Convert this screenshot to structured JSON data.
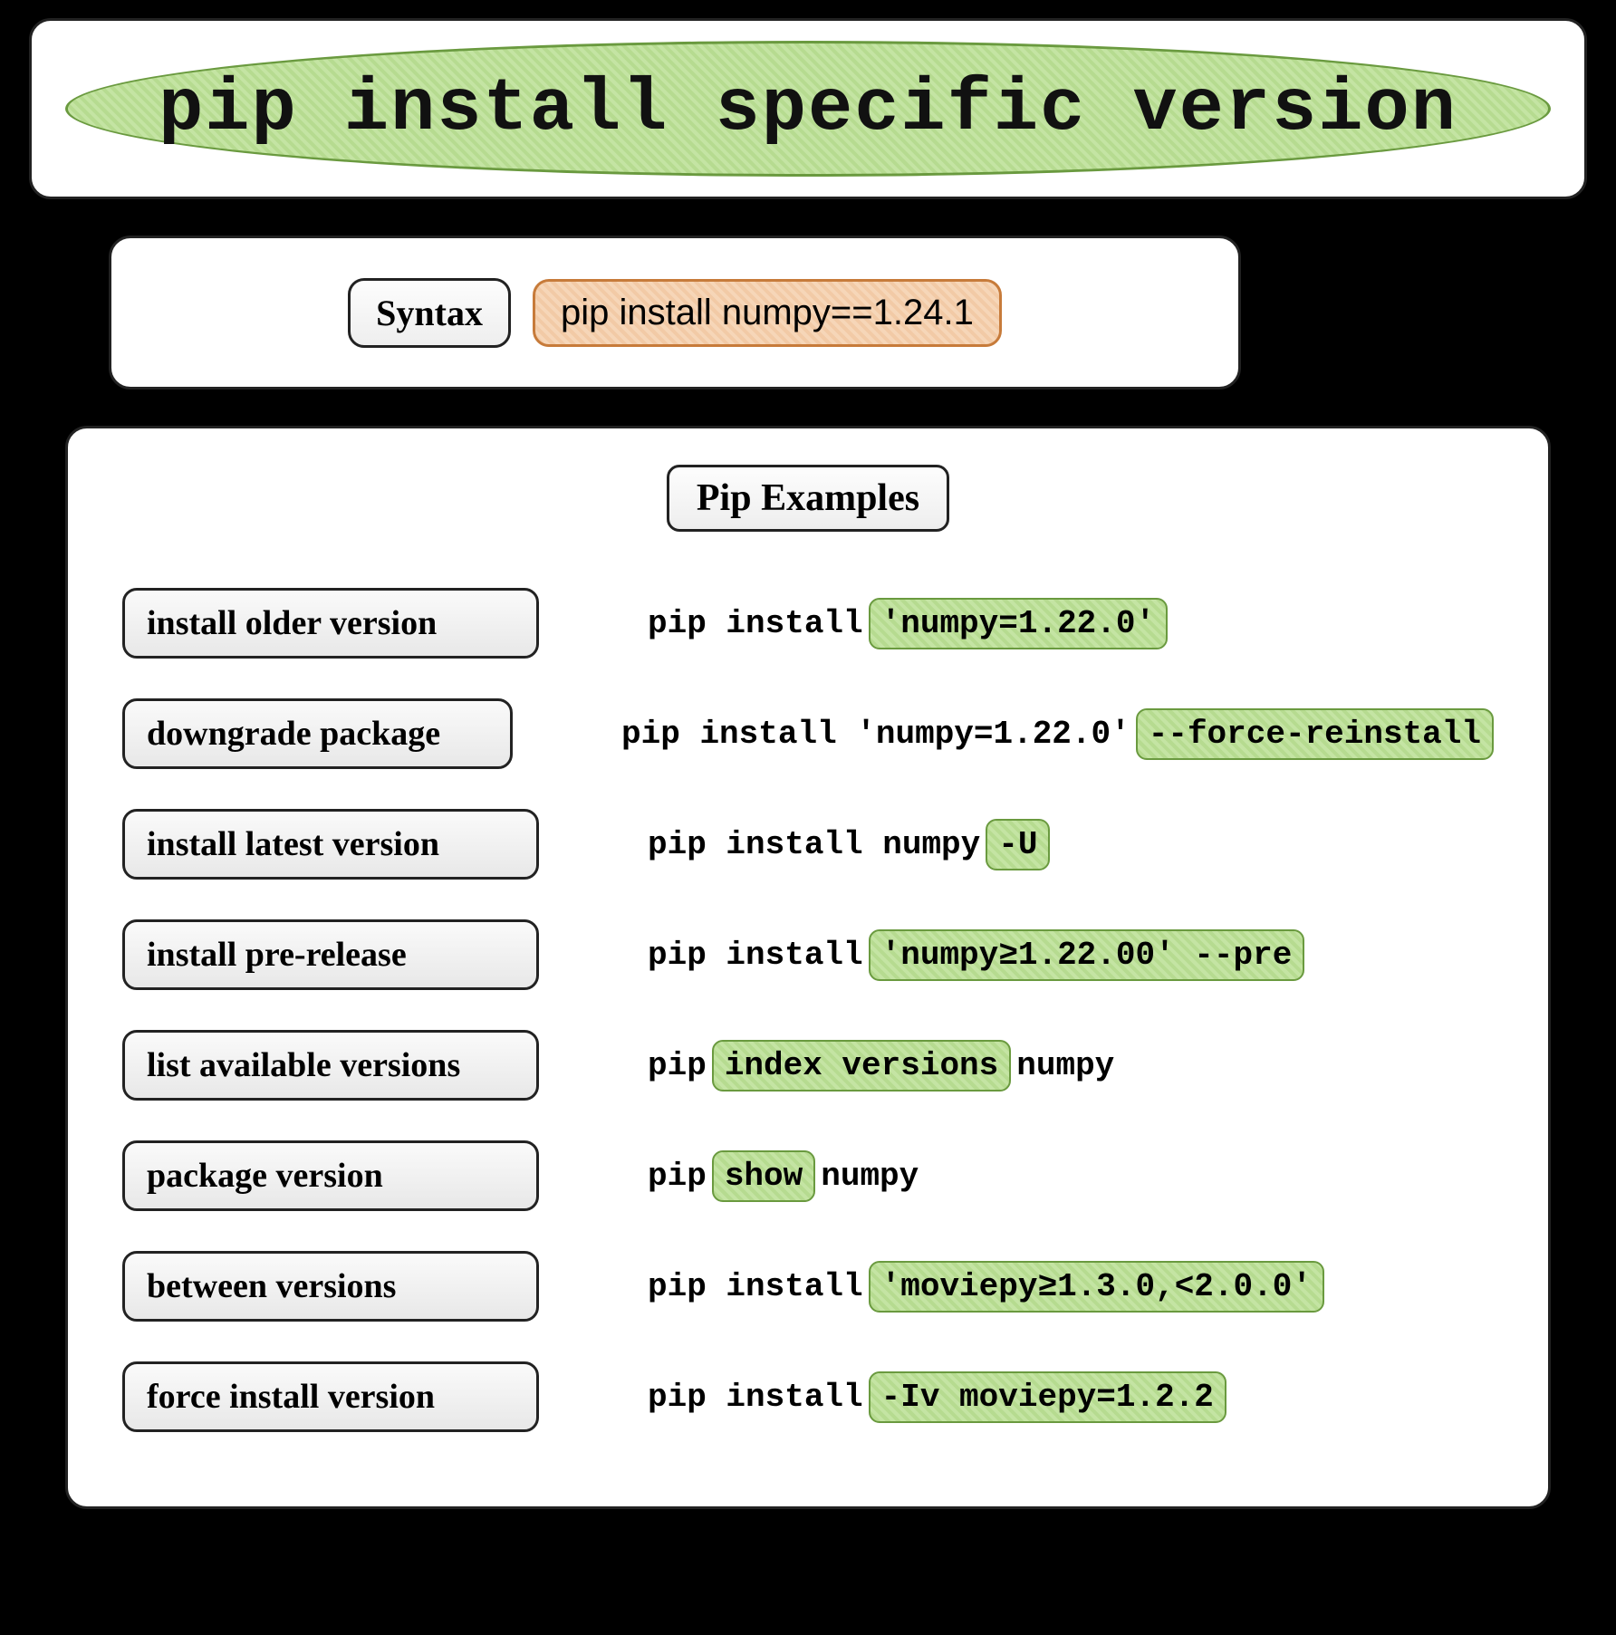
{
  "title": "pip install specific version",
  "syntax": {
    "label": "Syntax",
    "code": "pip install numpy==1.24.1"
  },
  "examples_heading": "Pip Examples",
  "rows": {
    "older": {
      "label": "install older version",
      "p1": "pip install ",
      "hl1": "'numpy=1.22.0'"
    },
    "downgrade": {
      "label": "downgrade package",
      "p1": "pip install 'numpy=1.22.0'",
      "hl1": "--force-reinstall"
    },
    "latest": {
      "label": "install latest version",
      "p1": "pip install numpy",
      "hl1": "-U"
    },
    "pre": {
      "label": "install pre-release",
      "p1": "pip install ",
      "hl1": "'numpy≥1.22.00' --pre"
    },
    "list": {
      "label": "list available versions",
      "p1": "pip ",
      "hl1": "index versions",
      "p2": " numpy"
    },
    "show": {
      "label": "package version",
      "p1": "pip ",
      "hl1": "show",
      "p2": " numpy"
    },
    "between": {
      "label": "between versions",
      "p1": "pip install ",
      "hl1": "'moviepy≥1.3.0,<2.0.0'"
    },
    "force": {
      "label": "force install version",
      "p1": "pip install ",
      "hl1": "-Iv moviepy=1.2.2"
    }
  }
}
